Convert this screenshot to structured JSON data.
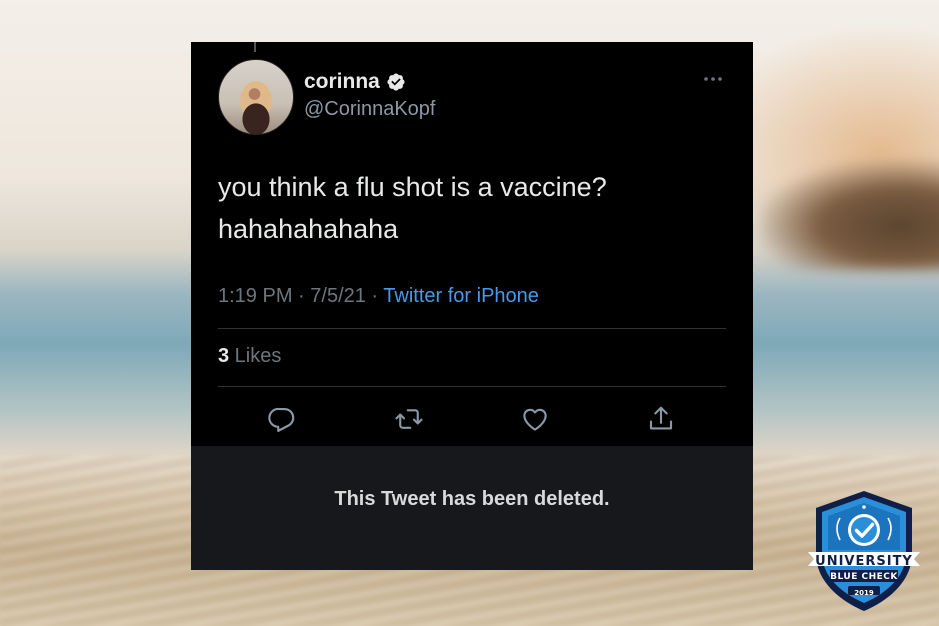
{
  "tweet": {
    "display_name": "corinna",
    "handle": "@CorinnaKopf",
    "verified": true,
    "more_icon": "more-horizontal-icon",
    "text_lines": [
      "you think a flu shot is a vaccine?",
      "hahahahahaha"
    ],
    "time": "1:19 PM",
    "separator_1": " · ",
    "date": "7/5/21",
    "separator_2": " · ",
    "source": "Twitter for iPhone",
    "likes_count": "3",
    "likes_label": " Likes",
    "actions": [
      {
        "name": "reply",
        "icon": "reply-icon"
      },
      {
        "name": "retweet",
        "icon": "retweet-icon"
      },
      {
        "name": "like",
        "icon": "heart-icon"
      },
      {
        "name": "share",
        "icon": "share-icon"
      }
    ],
    "deleted_notice": "This Tweet has been deleted."
  },
  "badge": {
    "line1": "UNIVERSITY",
    "line2": "BLUE CHECK",
    "year": "2019"
  },
  "colors": {
    "card_bg": "#000000",
    "text_primary": "#e7e9ea",
    "text_secondary": "#6e767d",
    "link": "#4a99e9",
    "verified": "#e7e9ea",
    "deleted_panel": "#16181c",
    "badge_blue": "#2a8fd8",
    "badge_navy": "#0f1f48"
  }
}
